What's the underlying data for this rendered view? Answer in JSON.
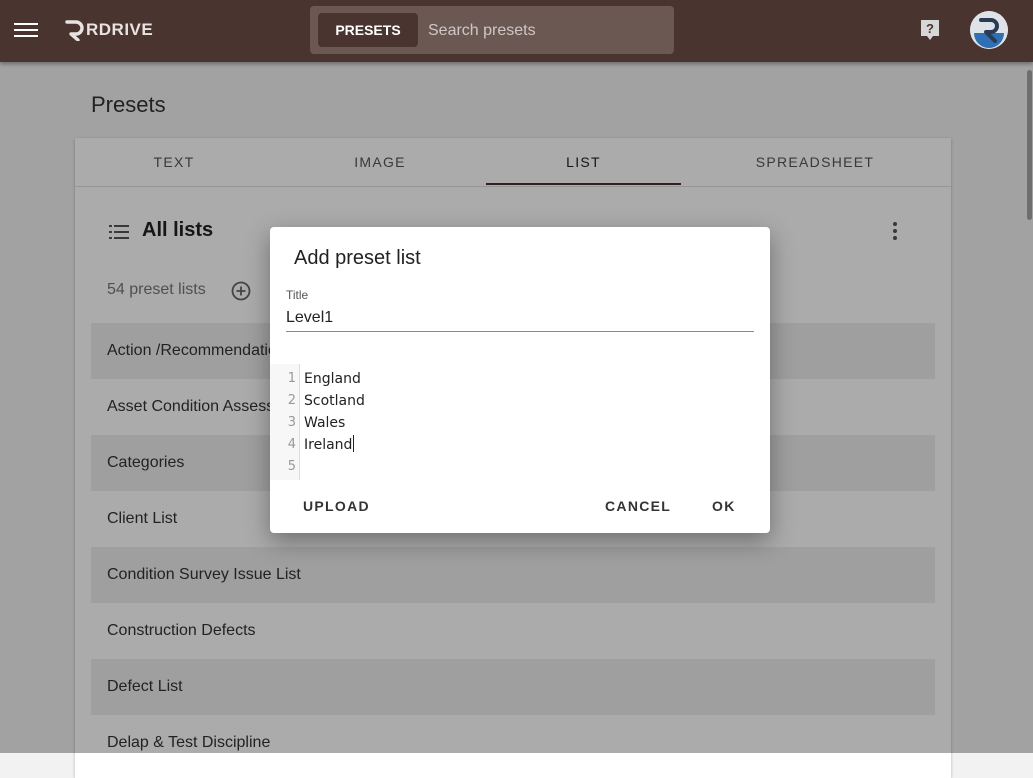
{
  "app": {
    "logo_text": "RDRIVE",
    "search_chip": "PRESETS",
    "search_placeholder": "Search presets"
  },
  "page": {
    "title": "Presets"
  },
  "tabs": [
    {
      "label": "TEXT"
    },
    {
      "label": "IMAGE"
    },
    {
      "label": "LIST"
    },
    {
      "label": "SPREADSHEET"
    }
  ],
  "list_panel": {
    "title": "All lists",
    "count_text": "54 preset lists",
    "rows": [
      "Action /Recommendation",
      "Asset Condition Assessment",
      "Categories",
      "Client List",
      "Condition Survey Issue List",
      "Construction Defects",
      "Defect List",
      "Delap & Test Discipline"
    ]
  },
  "dialog": {
    "title": "Add preset list",
    "field_label": "Title",
    "field_value": "Level1",
    "editor_lines": [
      {
        "no": "1",
        "text": "England"
      },
      {
        "no": "2",
        "text": "Scotland"
      },
      {
        "no": "3",
        "text": "Wales"
      },
      {
        "no": "4",
        "text": "Ireland"
      },
      {
        "no": "5",
        "text": ""
      }
    ],
    "upload_label": "UPLOAD",
    "cancel_label": "CANCEL",
    "ok_label": "OK"
  },
  "colors": {
    "appbar": "#4a342f",
    "search_box": "#6b5853",
    "row_alt": "#eeeeee",
    "accent": "#4a342f"
  },
  "icons": {
    "menu": "menu-icon",
    "help": "help-icon",
    "list": "list-icon",
    "more": "more-vert-icon",
    "add": "add-circle-icon"
  }
}
